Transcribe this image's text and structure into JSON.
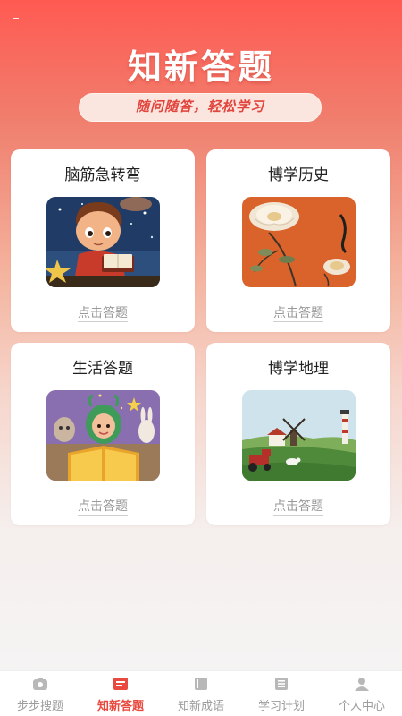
{
  "header": {
    "title": "知新答题",
    "slogan": "随问随答，轻松学习"
  },
  "cards": [
    {
      "title": "脑筋急转弯",
      "action": "点击答题",
      "image": "boy-reading-book-illustration"
    },
    {
      "title": "博学历史",
      "action": "点击答题",
      "image": "chinese-peony-painting"
    },
    {
      "title": "生活答题",
      "action": "点击答题",
      "image": "child-reading-with-animals-illustration"
    },
    {
      "title": "博学地理",
      "action": "点击答题",
      "image": "windmill-farm-landscape"
    }
  ],
  "tabbar": {
    "active_index": 1,
    "active_color": "#e94a3f",
    "items": [
      {
        "label": "步步搜题",
        "icon": "camera-icon"
      },
      {
        "label": "知新答题",
        "icon": "quiz-book-icon"
      },
      {
        "label": "知新成语",
        "icon": "book-icon"
      },
      {
        "label": "学习计划",
        "icon": "plan-list-icon"
      },
      {
        "label": "个人中心",
        "icon": "user-icon"
      }
    ]
  }
}
